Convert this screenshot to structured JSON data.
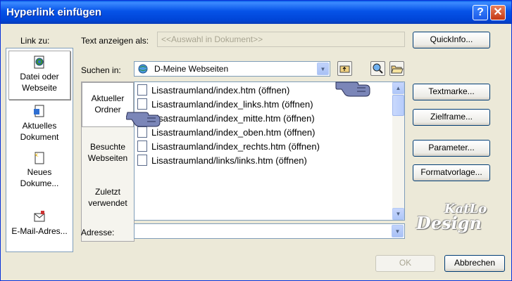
{
  "window": {
    "title": "Hyperlink einfügen",
    "help_glyph": "?",
    "close_glyph": "✕"
  },
  "left_label": "Link zu:",
  "nav": [
    {
      "line1": "Datei oder",
      "line2": "Webseite"
    },
    {
      "line1": "Aktuelles",
      "line2": "Dokument"
    },
    {
      "line1": "Neues",
      "line2": "Dokume..."
    },
    {
      "line1": "E-Mail-Adres...",
      "line2": ""
    }
  ],
  "display_text": {
    "label": "Text anzeigen als:",
    "placeholder": "<<Auswahl in Dokument>>"
  },
  "search": {
    "label": "Suchen in:",
    "value": "D-Meine Webseiten"
  },
  "subnav": [
    {
      "line1": "Aktueller",
      "line2": "Ordner"
    },
    {
      "line1": "Besuchte",
      "line2": "Webseiten"
    },
    {
      "line1": "Zuletzt",
      "line2": "verwendet"
    }
  ],
  "files": [
    "Lisastraumland/index.htm (öffnen)",
    "Lisastraumland/index_links.htm (öffnen)",
    "Lisastraumland/index_mitte.htm (öffnen)",
    "Lisastraumland/index_oben.htm (öffnen)",
    "Lisastraumland/index_rechts.htm (öffnen)",
    "Lisastraumland/links/links.htm (öffnen)"
  ],
  "address": {
    "label": "Adresse:",
    "value": ""
  },
  "buttons": {
    "quickinfo": "QuickInfo...",
    "textmarke": "Textmarke...",
    "zielframe": "Zielframe...",
    "parameter": "Parameter...",
    "formatvorlage": "Formatvorlage...",
    "ok": "OK",
    "cancel": "Abbrechen"
  },
  "watermark": {
    "line1": "KatLo",
    "line2": "Design"
  }
}
